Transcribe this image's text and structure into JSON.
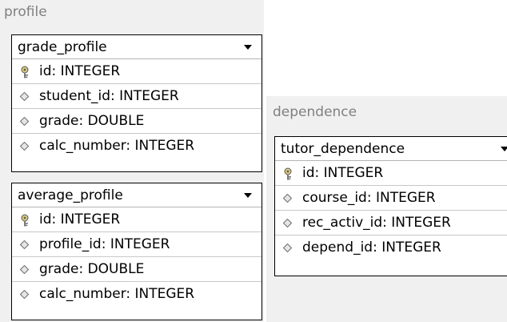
{
  "groups": {
    "profile": {
      "label": "profile",
      "tables": [
        {
          "name": "grade_profile",
          "fields": [
            {
              "text": "id: INTEGER",
              "icon": "primary-key-icon"
            },
            {
              "text": "student_id: INTEGER",
              "icon": "column-diamond-icon"
            },
            {
              "text": "grade: DOUBLE",
              "icon": "column-diamond-icon"
            },
            {
              "text": "calc_number: INTEGER",
              "icon": "column-diamond-icon"
            }
          ]
        },
        {
          "name": "average_profile",
          "fields": [
            {
              "text": "id: INTEGER",
              "icon": "primary-key-icon"
            },
            {
              "text": "profile_id: INTEGER",
              "icon": "column-diamond-icon"
            },
            {
              "text": "grade: DOUBLE",
              "icon": "column-diamond-icon"
            },
            {
              "text": "calc_number: INTEGER",
              "icon": "column-diamond-icon"
            }
          ]
        }
      ]
    },
    "dependence": {
      "label": "dependence",
      "tables": [
        {
          "name": "tutor_dependence",
          "fields": [
            {
              "text": "id: INTEGER",
              "icon": "primary-key-icon"
            },
            {
              "text": "course_id: INTEGER",
              "icon": "column-diamond-icon"
            },
            {
              "text": "rec_activ_id: INTEGER",
              "icon": "column-diamond-icon"
            },
            {
              "text": "depend_id: INTEGER",
              "icon": "column-diamond-icon"
            }
          ]
        }
      ]
    }
  }
}
